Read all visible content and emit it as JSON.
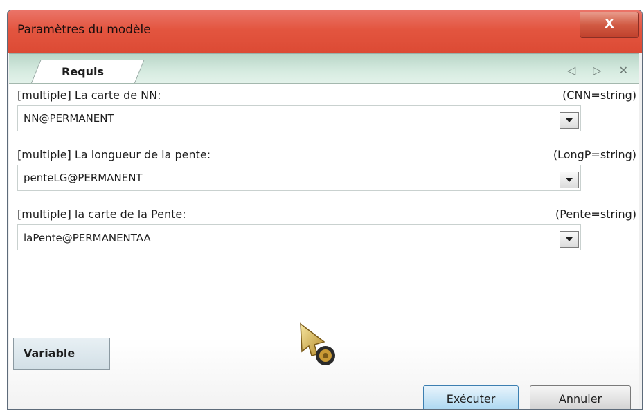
{
  "window": {
    "title": "Paramètres du modèle",
    "close_label": "X"
  },
  "tabs_top": {
    "active_label": "Requis",
    "controls": "◁ ▷ ✕"
  },
  "fields": [
    {
      "label": "[multiple] La carte de NN:",
      "type": "(CNN=string)",
      "value": "NN@PERMANENT"
    },
    {
      "label": "[multiple] La longueur de la pente:",
      "type": "(LongP=string)",
      "value": "penteLG@PERMANENT"
    },
    {
      "label": "[multiple] la carte de la Pente:",
      "type": "(Pente=string)",
      "value": "laPente@PERMANENTAA"
    }
  ],
  "tabs_bottom": {
    "label": "Variable"
  },
  "buttons": {
    "execute": "Exécuter",
    "cancel": "Annuler"
  },
  "colors": {
    "titlebar": "#e3553f",
    "tabstrip": "#d6ebe0",
    "execute_button": "#c9e5f6"
  },
  "icons": {
    "cursor": "busy-cursor-icon"
  }
}
